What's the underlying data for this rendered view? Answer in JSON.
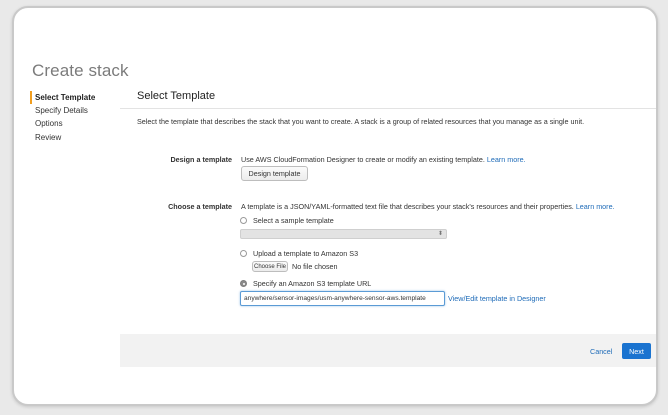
{
  "page": {
    "title": "Create stack"
  },
  "steps": [
    {
      "label": "Select Template",
      "active": true
    },
    {
      "label": "Specify Details",
      "active": false
    },
    {
      "label": "Options",
      "active": false
    },
    {
      "label": "Review",
      "active": false
    }
  ],
  "section": {
    "title": "Select Template",
    "intro": "Select the template that describes the stack that you want to create. A stack is a group of related resources that you manage as a single unit."
  },
  "design": {
    "label": "Design a template",
    "description": "Use AWS CloudFormation Designer to create or modify an existing template.",
    "learn_more": "Learn more.",
    "button_label": "Design template"
  },
  "choose": {
    "label": "Choose a template",
    "description": "A template is a JSON/YAML-formatted text file that describes your stack's resources and their properties.",
    "learn_more": "Learn more.",
    "option_sample": "Select a sample template",
    "sample_select_value": "",
    "option_upload": "Upload a template to Amazon S3",
    "choose_file_label": "Choose File",
    "no_file_text": "No file chosen",
    "option_url": "Specify an Amazon S3 template URL",
    "url_value": "anywhere/sensor-images/usm-anywhere-sensor-aws.template",
    "view_edit_link": "View/Edit template in Designer",
    "selected_option": "url"
  },
  "footer": {
    "cancel_label": "Cancel",
    "next_label": "Next"
  },
  "colors": {
    "accent_step": "#f19e1f",
    "primary_button": "#1a73d0",
    "link": "#1e6bb8"
  }
}
